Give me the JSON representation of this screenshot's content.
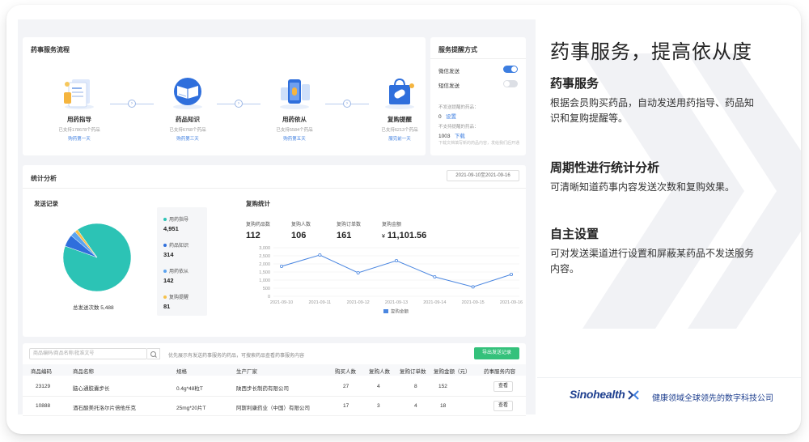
{
  "flow": {
    "title": "药事服务流程",
    "steps": [
      {
        "name": "用药指导",
        "sub": "已支持178678个药品",
        "link": "购药第一天"
      },
      {
        "name": "药品知识",
        "sub": "已支持6768个药品",
        "link": "购药第三天"
      },
      {
        "name": "用药依从",
        "sub": "已支持5584个药品",
        "link": "购药第五天"
      },
      {
        "name": "复购提醒",
        "sub": "已支持6213个药品",
        "link": "服完前一天"
      }
    ]
  },
  "reminder": {
    "title": "服务提醒方式",
    "wechat_label": "微信发送",
    "wechat_on": true,
    "sms_label": "短信发送",
    "sms_on": false,
    "not_sent_label": "不发送提醒的药品：",
    "not_sent_count": "0",
    "set_link": "设置",
    "unsupported_label": "不支持提醒的药品：",
    "unsupported_count": "1003",
    "download_link": "下载",
    "note": "下载文档填写新的药品内容，发给我们后开通"
  },
  "stats": {
    "title": "统计分析",
    "date_range": "2021-09-10至2021-09-16",
    "send_title": "发送记录",
    "send_total": "总发送次数 5,488",
    "legend": [
      {
        "name": "用药指导",
        "value": "4,951",
        "color": "#2cc3b5"
      },
      {
        "name": "药品知识",
        "value": "314",
        "color": "#2f6fdc"
      },
      {
        "name": "用药依从",
        "value": "142",
        "color": "#5ba3ef"
      },
      {
        "name": "复购提醒",
        "value": "81",
        "color": "#f5c14a"
      }
    ],
    "repurchase_title": "复购统计",
    "kpis": [
      {
        "label": "复购药品数",
        "value": "112",
        "currency": ""
      },
      {
        "label": "复购人数",
        "value": "106",
        "currency": ""
      },
      {
        "label": "复购订单数",
        "value": "161",
        "currency": ""
      },
      {
        "label": "复购金额",
        "value": "11,101.56",
        "currency": "¥"
      }
    ]
  },
  "chart_data": [
    {
      "type": "pie",
      "categories": [
        "用药指导",
        "药品知识",
        "用药依从",
        "复购提醒"
      ],
      "values": [
        4951,
        314,
        142,
        81
      ],
      "title": "发送记录"
    },
    {
      "type": "line",
      "x": [
        "2021-09-10",
        "2021-09-11",
        "2021-09-12",
        "2021-09-13",
        "2021-09-14",
        "2021-09-15",
        "2021-09-16"
      ],
      "series": [
        {
          "name": "复购金额",
          "values": [
            1850,
            2550,
            1450,
            2200,
            1200,
            580,
            1350
          ]
        }
      ],
      "yticks": [
        "3,000",
        "2,500",
        "2,000",
        "1,500",
        "1,000",
        "500",
        "0"
      ],
      "ylim": [
        0,
        3000
      ],
      "legend": "bottom",
      "grid": true
    }
  ],
  "table": {
    "search_placeholder": "商品编码/商品名称/批准文号",
    "hint": "优先展示有发送药事服务的药品，可搜索药品查看药事服务内容",
    "export_label": "导出发送记录",
    "headers": [
      "商品编码",
      "商品名称",
      "规格",
      "生产厂家",
      "购买人数",
      "复购人数",
      "复购订单数",
      "复购金额（元）",
      "药事服务内容"
    ],
    "rows": [
      [
        "23129",
        "脑心通胶囊步长",
        "0.4g*48粒T",
        "陕西步长制药有限公司",
        "27",
        "4",
        "8",
        "152"
      ],
      [
        "10888",
        "酒石酸美托洛尔片倍他乐克",
        "25mg*20片T",
        "阿斯利康药业（中国）有限公司",
        "17",
        "3",
        "4",
        "18"
      ]
    ],
    "view_label": "查看"
  },
  "panel": {
    "title": "药事服务，提高依从度",
    "sections": [
      {
        "heading": "药事服务",
        "text": "根据会员购买药品，自动发送用药指导、药品知识和复购提醒等。"
      },
      {
        "heading": "周期性进行统计分析",
        "text": "可清晰知道药事内容发送次数和复购效果。"
      },
      {
        "heading": "自主设置",
        "text": "可对发送渠道进行设置和屏蔽某药品不发送服务内容。"
      }
    ],
    "brand": "Sinohealth",
    "slogan": "健康领域全球领先的数字科技公司"
  }
}
